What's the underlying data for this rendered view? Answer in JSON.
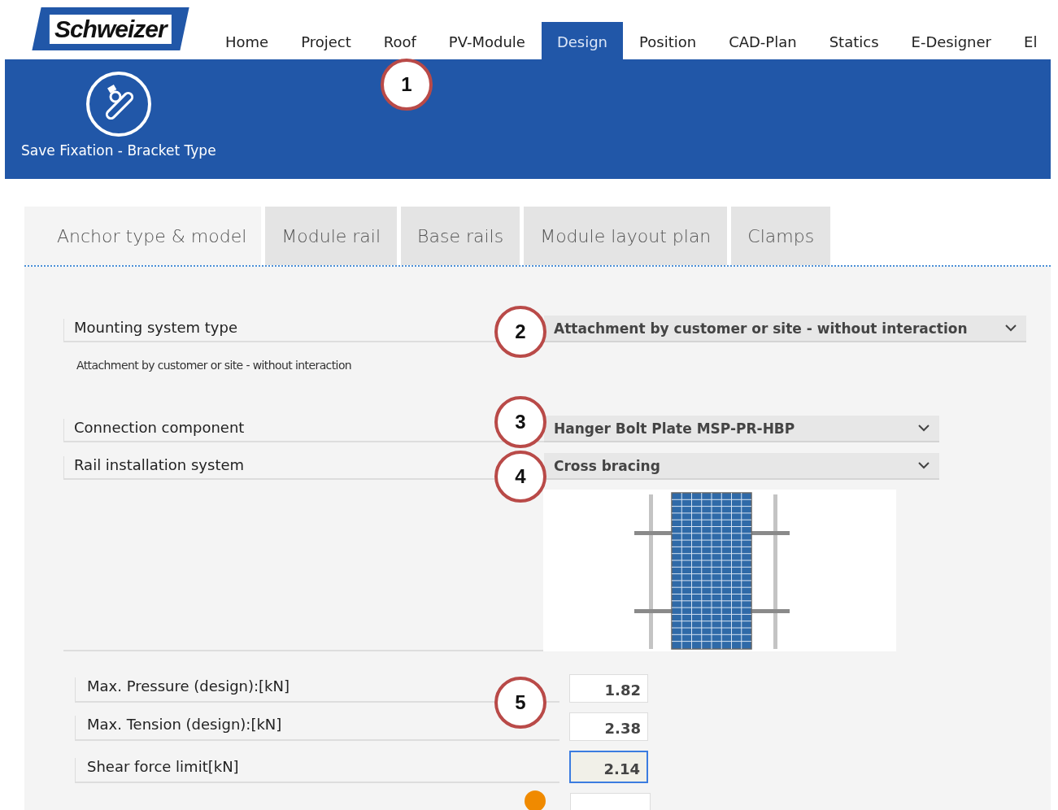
{
  "logo": {
    "text": "Schweizer"
  },
  "nav": [
    {
      "label": "Home",
      "selected": false
    },
    {
      "label": "Project",
      "selected": false
    },
    {
      "label": "Roof",
      "selected": false
    },
    {
      "label": "PV-Module",
      "selected": false
    },
    {
      "label": "Design",
      "selected": true
    },
    {
      "label": "Position",
      "selected": false
    },
    {
      "label": "CAD-Plan",
      "selected": false
    },
    {
      "label": "Statics",
      "selected": false
    },
    {
      "label": "E-Designer",
      "selected": false
    },
    {
      "label": "El",
      "selected": false
    }
  ],
  "toolbar": {
    "button": "Save Fixation - Bracket Type"
  },
  "tabs": [
    {
      "label": "Anchor type & model",
      "selected": true
    },
    {
      "label": "Module rail",
      "selected": false
    },
    {
      "label": "Base rails",
      "selected": false
    },
    {
      "label": "Module layout plan",
      "selected": false
    },
    {
      "label": "Clamps",
      "selected": false
    }
  ],
  "mounting": {
    "label": "Mounting system type",
    "value": "Attachment by customer or site - without interaction",
    "note": "Attachment by customer or site - without interaction"
  },
  "selects": [
    {
      "label": "Connection component",
      "value": "Hanger Bolt Plate MSP-PR-HBP"
    },
    {
      "label": "Rail installation system",
      "value": "Cross bracing"
    }
  ],
  "values": [
    {
      "label": "Max. Pressure (design):[kN]",
      "value": "1.82",
      "focused": false
    },
    {
      "label": "Max. Tension (design):[kN]",
      "value": "2.38",
      "focused": false
    },
    {
      "label": "Shear force limit[kN]",
      "value": "2.14",
      "focused": true
    }
  ],
  "callouts": [
    "1",
    "2",
    "3",
    "4",
    "5"
  ]
}
